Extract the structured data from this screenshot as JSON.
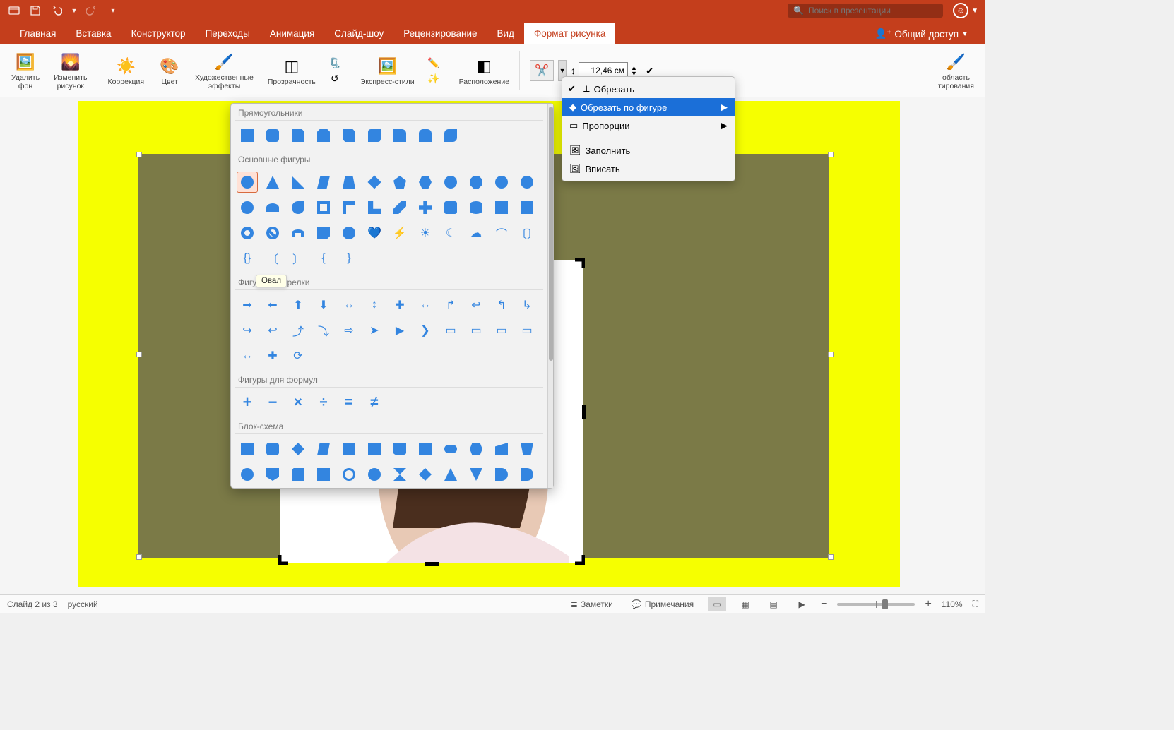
{
  "search": {
    "placeholder": "Поиск в презентации"
  },
  "tabs": {
    "home": "Главная",
    "insert": "Вставка",
    "design": "Конструктор",
    "transitions": "Переходы",
    "animations": "Анимация",
    "slideshow": "Слайд-шоу",
    "review": "Рецензирование",
    "view": "Вид",
    "pictureformat": "Формат рисунка"
  },
  "share": "Общий доступ",
  "ribbon": {
    "remove_bg_1": "Удалить",
    "remove_bg_2": "фон",
    "change_pic_1": "Изменить",
    "change_pic_2": "рисунок",
    "corrections": "Коррекция",
    "color": "Цвет",
    "artistic_1": "Художественные",
    "artistic_2": "эффекты",
    "transparency": "Прозрачность",
    "quick_styles": "Экспресс-стили",
    "arrange": "Расположение",
    "height_value": "12,46 см",
    "crop_region_1": "область",
    "crop_region_2": "тирования"
  },
  "crop_menu": {
    "crop": "Обрезать",
    "crop_to_shape": "Обрезать по фигуре",
    "aspect": "Пропорции",
    "fill": "Заполнить",
    "fit": "Вписать"
  },
  "shapes": {
    "cat_rect": "Прямоугольники",
    "cat_basic": "Основные фигуры",
    "cat_arrows": "Фигурные стрелки",
    "cat_formula": "Фигуры для формул",
    "cat_flowchart": "Блок-схема",
    "tooltip_oval": "Овал"
  },
  "status": {
    "slide": "Слайд 2 из 3",
    "lang": "русский",
    "notes": "Заметки",
    "comments": "Примечания",
    "zoom": "110%"
  }
}
